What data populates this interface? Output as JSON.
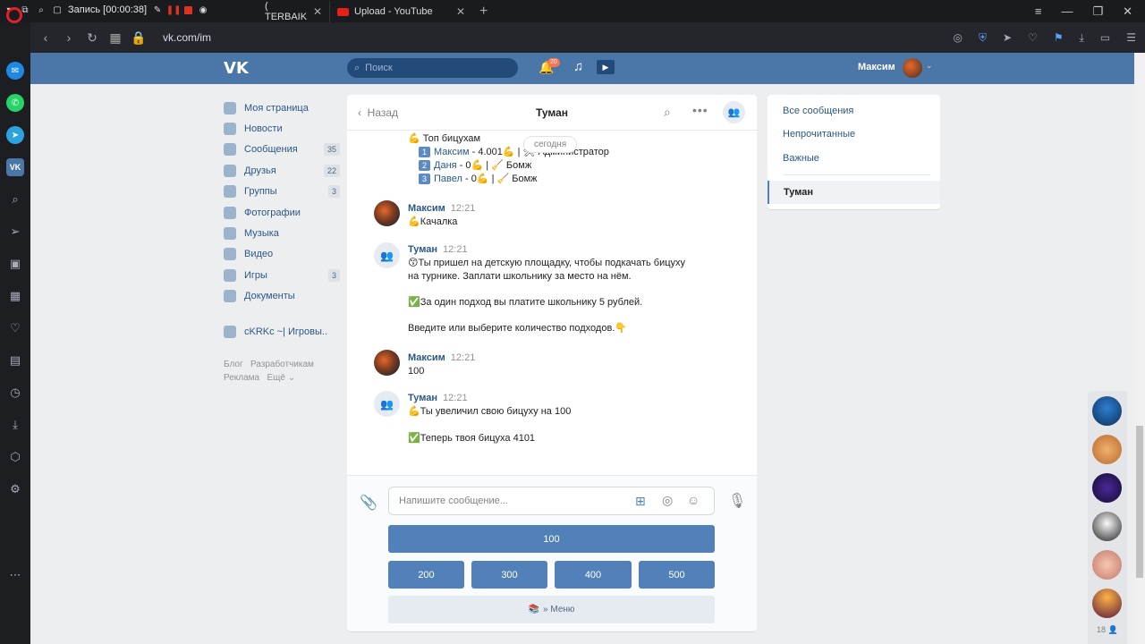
{
  "browser": {
    "recorder_label": "Запись [00:00:38]",
    "tabs": [
      {
        "title": "( TERBAIK"
      },
      {
        "title": "Upload - YouTube"
      }
    ],
    "url": "vk.com/im"
  },
  "vk_header": {
    "logo": "VK",
    "search_placeholder": "Поиск",
    "notifications_count": "20",
    "user_name": "Максим"
  },
  "left_menu": {
    "items": [
      {
        "label": "Моя страница",
        "count": ""
      },
      {
        "label": "Новости",
        "count": ""
      },
      {
        "label": "Сообщения",
        "count": "35"
      },
      {
        "label": "Друзья",
        "count": "22"
      },
      {
        "label": "Группы",
        "count": "3"
      },
      {
        "label": "Фотографии",
        "count": ""
      },
      {
        "label": "Музыка",
        "count": ""
      },
      {
        "label": "Видео",
        "count": ""
      },
      {
        "label": "Игры",
        "count": "3"
      },
      {
        "label": "Документы",
        "count": ""
      }
    ],
    "community": "cKRKc ~| Игровы..",
    "footer": {
      "blog": "Блог",
      "dev": "Разработчикам",
      "ads": "Реклама",
      "more": "Ещё"
    }
  },
  "chat": {
    "back_label": "Назад",
    "title": "Туман",
    "date_pill": "сегодня",
    "top": {
      "heading": "💪 Топ бицухам",
      "rows": [
        {
          "n": "1",
          "name": "Максим",
          "rest": " - 4.001💪 | 🛠 Администратор"
        },
        {
          "n": "2",
          "name": "Даня",
          "rest": " - 0💪 | 🧹 Бомж"
        },
        {
          "n": "3",
          "name": "Павел",
          "rest": " - 0💪 | 🧹 Бомж"
        }
      ]
    },
    "messages": [
      {
        "author": "Максим",
        "time": "12:21",
        "lines": [
          "💪Качалка"
        ]
      },
      {
        "author": "Туман",
        "time": "12:21",
        "lines": [
          "😙Ты пришел на детскую площадку, чтобы подкачать бицуху",
          "на турнике. Заплати школьнику за место на нём.",
          "✅За один подход вы платите школьнику 5 рублей.",
          "Введите или выберите количество подходов.👇"
        ]
      },
      {
        "author": "Максим",
        "time": "12:21",
        "lines": [
          "100"
        ]
      },
      {
        "author": "Туман",
        "time": "12:21",
        "lines": [
          "💪Ты увеличил свою бицуху на 100",
          "✅Теперь твоя бицуха 4101"
        ]
      }
    ],
    "input_placeholder": "Напишите сообщение...",
    "keyboard": {
      "row1": [
        "100"
      ],
      "row2": [
        "200",
        "300",
        "400",
        "500"
      ],
      "menu": "» Меню"
    }
  },
  "right_panel": {
    "all": "Все сообщения",
    "unread": "Непрочитанные",
    "important": "Важные",
    "selected": "Туман"
  },
  "dock": {
    "count": "18"
  }
}
